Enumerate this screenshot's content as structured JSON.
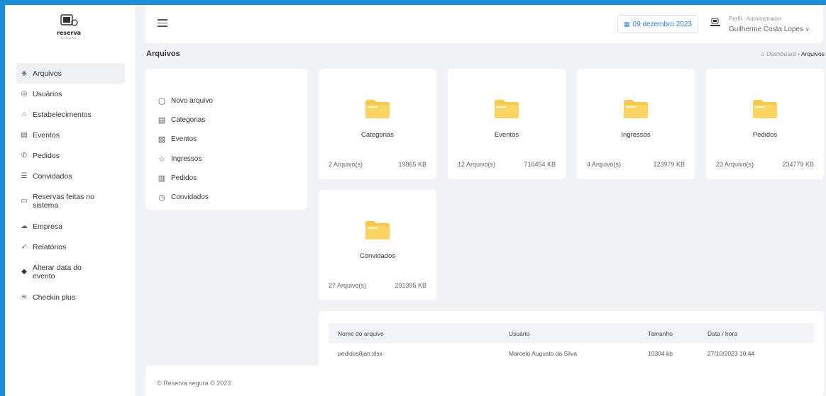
{
  "app": {
    "logo_text": "reserva",
    "logo_sub": "SEGURA"
  },
  "sidebar": {
    "items": [
      {
        "label": "Arquivos",
        "icon": "layers-icon",
        "active": true
      },
      {
        "label": "Usuários",
        "icon": "user-icon"
      },
      {
        "label": "Estabelecimentos",
        "icon": "building-icon"
      },
      {
        "label": "Eventos",
        "icon": "calendar-icon"
      },
      {
        "label": "Pedidos",
        "icon": "phone-icon"
      },
      {
        "label": "Convidados",
        "icon": "list-icon"
      },
      {
        "label": "Reservas feitas no sistema",
        "icon": "chat-icon"
      },
      {
        "label": "Empresa",
        "icon": "cloud-icon"
      },
      {
        "label": "Relatórios",
        "icon": "send-icon"
      },
      {
        "label": "Alterar data do evento",
        "icon": "diamond-icon"
      },
      {
        "label": "Checkin plus",
        "icon": "wave-icon"
      }
    ]
  },
  "header": {
    "date": "09 dezembro 2023",
    "profile_role": "Perfil - Administrador",
    "profile_name": "Guilherme Costa Lopes"
  },
  "page": {
    "title": "Arquivos",
    "breadcrumb_home": "Dashboard",
    "breadcrumb_current": "Arquivos"
  },
  "menu": {
    "items": [
      {
        "label": "Novo arquivo",
        "icon": "file-icon"
      },
      {
        "label": "Categorias",
        "icon": "document-icon"
      },
      {
        "label": "Eventos",
        "icon": "image-icon"
      },
      {
        "label": "Ingressos",
        "icon": "star-icon"
      },
      {
        "label": "Pedidos",
        "icon": "book-icon"
      },
      {
        "label": "Convidados",
        "icon": "clock-icon"
      }
    ]
  },
  "folders": [
    {
      "name": "Categorias",
      "count": "2 Arquivo(s)",
      "size": "19865 KB"
    },
    {
      "name": "Eventos",
      "count": "12 Arquivo(s)",
      "size": "716454 KB"
    },
    {
      "name": "Ingressos",
      "count": "4 Arquivo(s)",
      "size": "123979 KB"
    },
    {
      "name": "Pedidos",
      "count": "23 Arquivo(s)",
      "size": "234779 KB"
    },
    {
      "name": "Convidados",
      "count": "27 Arquivo(s)",
      "size": "291395 KB"
    }
  ],
  "table": {
    "headers": [
      "Nome do arquivo",
      "Usuário",
      "Tamanho",
      "Data / hora"
    ],
    "rows": [
      [
        "pedidos8jan.xlsx",
        "Marcelo Augusto da Silva",
        "10304 kb",
        "27/10/2023 10:44"
      ]
    ]
  },
  "footer": {
    "text": "© Reserva segura © 2023"
  },
  "colors": {
    "accent": "#2f7de0",
    "folder": "#f7c94b",
    "background": "#1a8fd8"
  }
}
